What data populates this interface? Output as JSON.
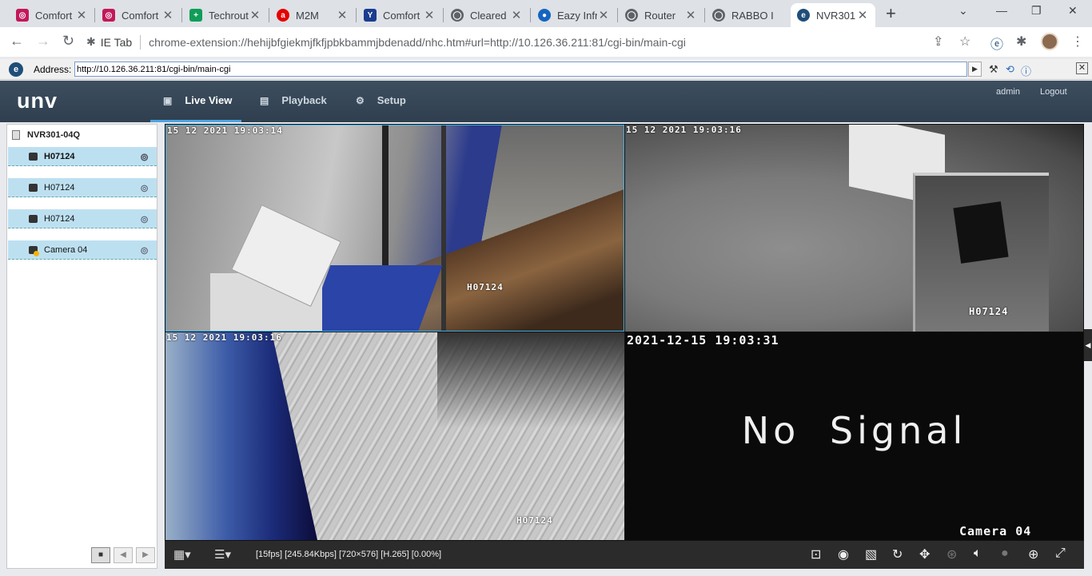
{
  "browser": {
    "tabs": [
      {
        "title": "Comfort",
        "favicon": "app-icon",
        "color": "#c2185b",
        "active": false
      },
      {
        "title": "Comfort",
        "favicon": "app-icon",
        "color": "#c2185b",
        "active": false
      },
      {
        "title": "Techrout",
        "favicon": "sheets-icon",
        "color": "#0f9d58",
        "active": false
      },
      {
        "title": "M2M",
        "favicon": "airtel-icon",
        "color": "#e40000",
        "active": false
      },
      {
        "title": "Comfort",
        "favicon": "y-icon",
        "color": "#1a3d8f",
        "active": false
      },
      {
        "title": "Cleared",
        "favicon": "globe-icon",
        "color": "#5f6368",
        "active": false
      },
      {
        "title": "Eazy Infr",
        "favicon": "eazy-icon",
        "color": "#1565c0",
        "active": false
      },
      {
        "title": "Router",
        "favicon": "globe-icon",
        "color": "#5f6368",
        "active": false
      },
      {
        "title": "RABBO I",
        "favicon": "globe-icon",
        "color": "#5f6368",
        "active": false
      },
      {
        "title": "NVR301",
        "favicon": "ie-tab-icon",
        "color": "#1f4e79",
        "active": true
      }
    ],
    "omnibox": {
      "extension_label": "IE Tab",
      "url": "chrome-extension://hehijbfgiekmjfkfjpbkbammjbdenadd/nhc.htm#url=http://10.126.36.211:81/cgi-bin/main-cgi"
    },
    "ie_bar": {
      "address_label": "Address:",
      "address_value": "http://10.126.36.211:81/cgi-bin/main-cgi"
    }
  },
  "nvr": {
    "brand": "unv",
    "nav": [
      {
        "label": "Live View",
        "icon": "monitor-icon",
        "active": true
      },
      {
        "label": "Playback",
        "icon": "film-icon",
        "active": false
      },
      {
        "label": "Setup",
        "icon": "gear-icon",
        "active": false
      }
    ],
    "user": "admin",
    "logout": "Logout",
    "device_name": "NVR301-04Q",
    "cameras": [
      {
        "name": "H07124",
        "selected": true,
        "warning": false
      },
      {
        "name": "H07124",
        "selected": false,
        "warning": false
      },
      {
        "name": "H07124",
        "selected": false,
        "warning": false
      },
      {
        "name": "Camera 04",
        "selected": false,
        "warning": true
      }
    ],
    "views": [
      {
        "timestamp": "15 12 2021  19:03:14",
        "label": "H07124"
      },
      {
        "timestamp": "15 12 2021  19:03:16",
        "label": "H07124"
      },
      {
        "timestamp": "15 12 2021  19:03:16",
        "label": "H07124"
      },
      {
        "timestamp": "2021-12-15  19:03:31",
        "label": "Camera 04",
        "message": "No Signal"
      }
    ],
    "status_text": "[15fps] [245.84Kbps] [720×576] [H.265] [0.00%]"
  }
}
